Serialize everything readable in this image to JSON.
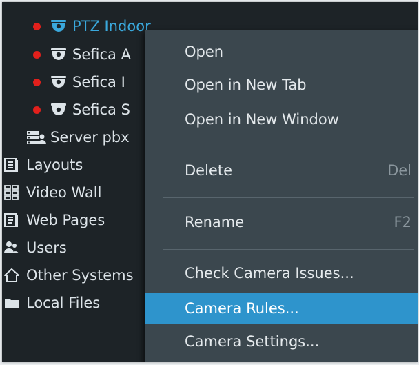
{
  "tree": {
    "cameras": [
      {
        "label": "PTZ Indoor",
        "selected": true
      },
      {
        "label": "Sefica A"
      },
      {
        "label": "Sefica I"
      },
      {
        "label": "Sefica S"
      }
    ],
    "server": {
      "label": "Server pbx"
    },
    "nodes": [
      {
        "label": "Layouts",
        "icon": "layouts-icon"
      },
      {
        "label": "Video Wall",
        "icon": "video-wall-icon"
      },
      {
        "label": "Web Pages",
        "icon": "web-pages-icon"
      },
      {
        "label": "Users",
        "icon": "users-icon"
      },
      {
        "label": "Other Systems",
        "icon": "other-systems-icon"
      },
      {
        "label": "Local Files",
        "icon": "folder-icon"
      }
    ]
  },
  "context_menu": {
    "open": "Open",
    "open_new_tab": "Open in New Tab",
    "open_new_window": "Open in New Window",
    "delete": "Delete",
    "delete_shortcut": "Del",
    "rename": "Rename",
    "rename_shortcut": "F2",
    "check_issues": "Check Camera Issues...",
    "camera_rules": "Camera Rules...",
    "camera_settings": "Camera Settings..."
  },
  "colors": {
    "tree_background": "#1d2327",
    "menu_background": "#3b474e",
    "highlight": "#2e94cc",
    "selected_text": "#3aa8dc",
    "status_offline": "#e2201c"
  }
}
